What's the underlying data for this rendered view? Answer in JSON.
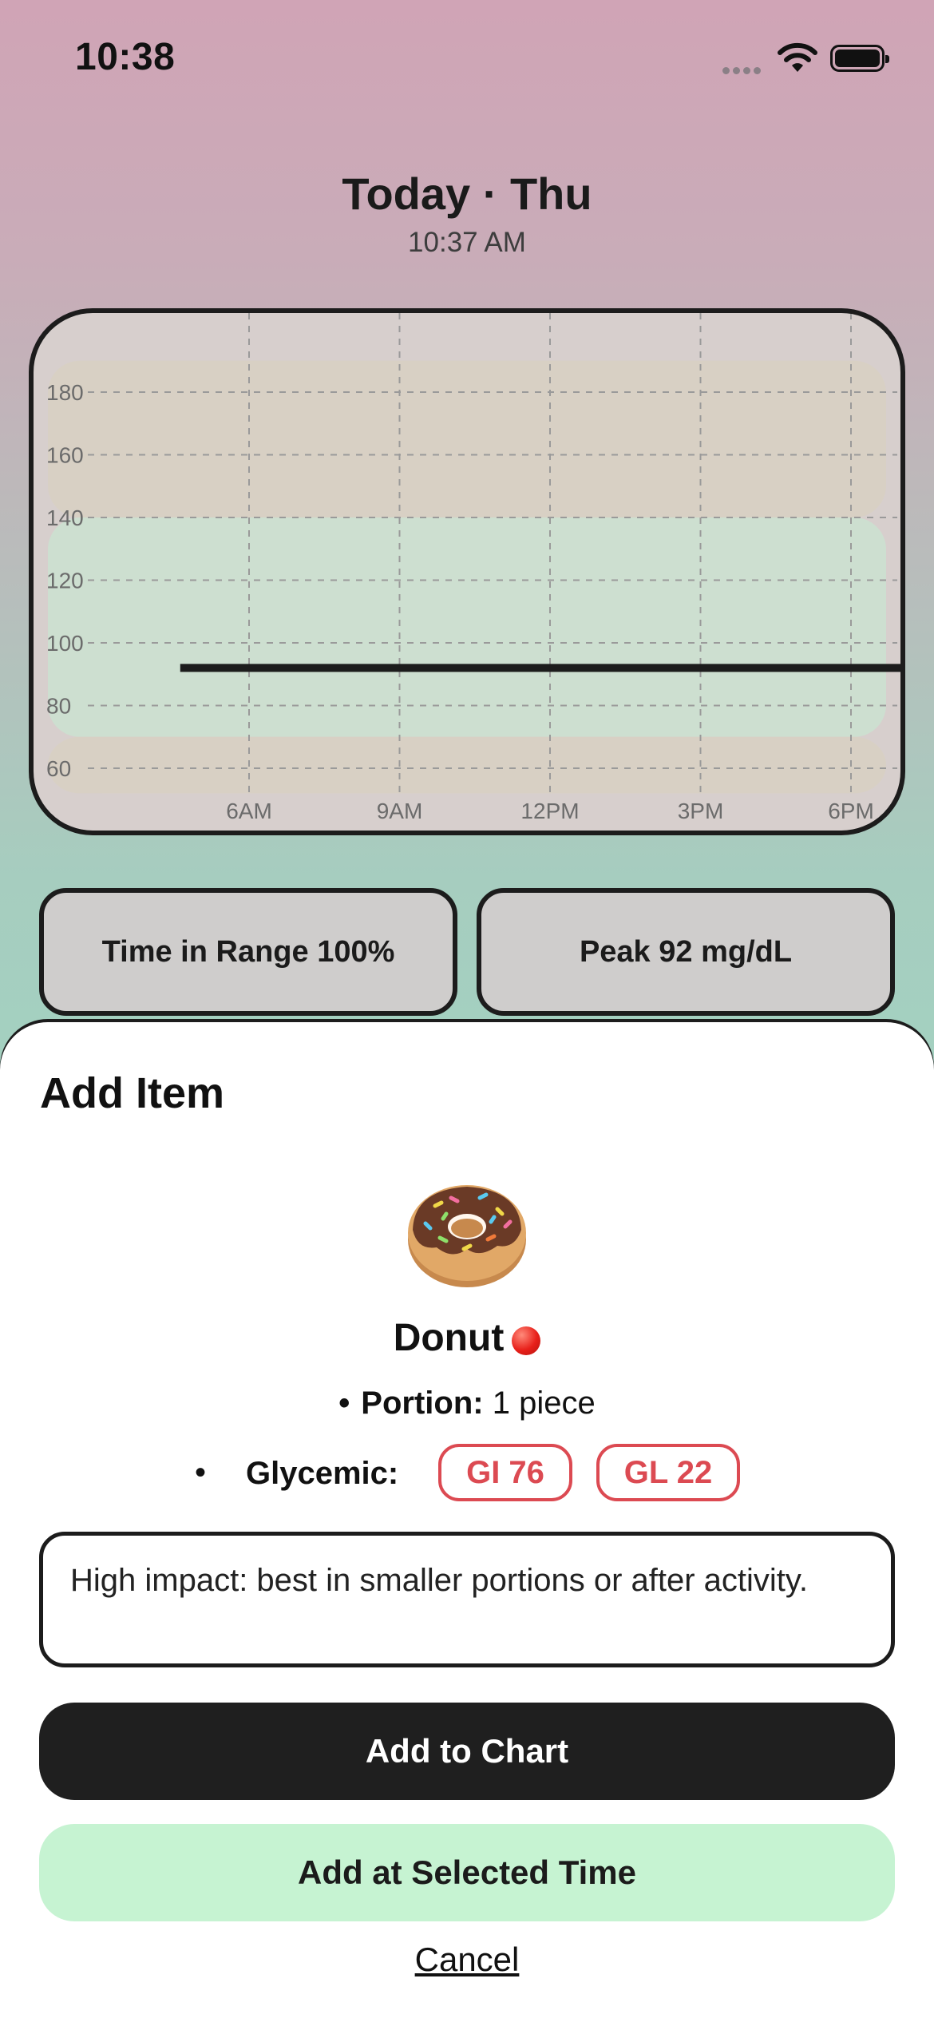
{
  "status_bar": {
    "time": "10:38"
  },
  "header": {
    "title": "Today · Thu",
    "time": "10:37 AM"
  },
  "chart_data": {
    "type": "line",
    "y_ticks": [
      180,
      160,
      140,
      120,
      100,
      80,
      60
    ],
    "x_ticks": [
      "6AM",
      "9AM",
      "12PM",
      "3PM",
      "6PM"
    ],
    "ylim": [
      55,
      195
    ],
    "series": [
      {
        "values": [
          92,
          92
        ]
      }
    ],
    "x_range_hours": [
      4.5,
      18.5
    ],
    "grid": true,
    "colors": {
      "line": "#1c1c1c",
      "range_band": "#cddfd0",
      "high_band": "#d8d0c4",
      "low_band": "#d8d0c4"
    }
  },
  "stats": {
    "time_in_range": "Time in Range 100%",
    "peak": "Peak 92 mg/dL"
  },
  "sheet": {
    "title": "Add Item",
    "food_name": "Donut",
    "portion_label": "Portion:",
    "portion_value": "1 piece",
    "glycemic_label": "Glycemic:",
    "gi": "GI 76",
    "gl": "GL 22",
    "note": "High impact: best in smaller portions or after activity.",
    "add_to_chart": "Add to Chart",
    "add_at_time": "Add at Selected Time",
    "cancel": "Cancel",
    "icons": {
      "food": "donut-icon",
      "impact": "red-circle-icon"
    }
  }
}
